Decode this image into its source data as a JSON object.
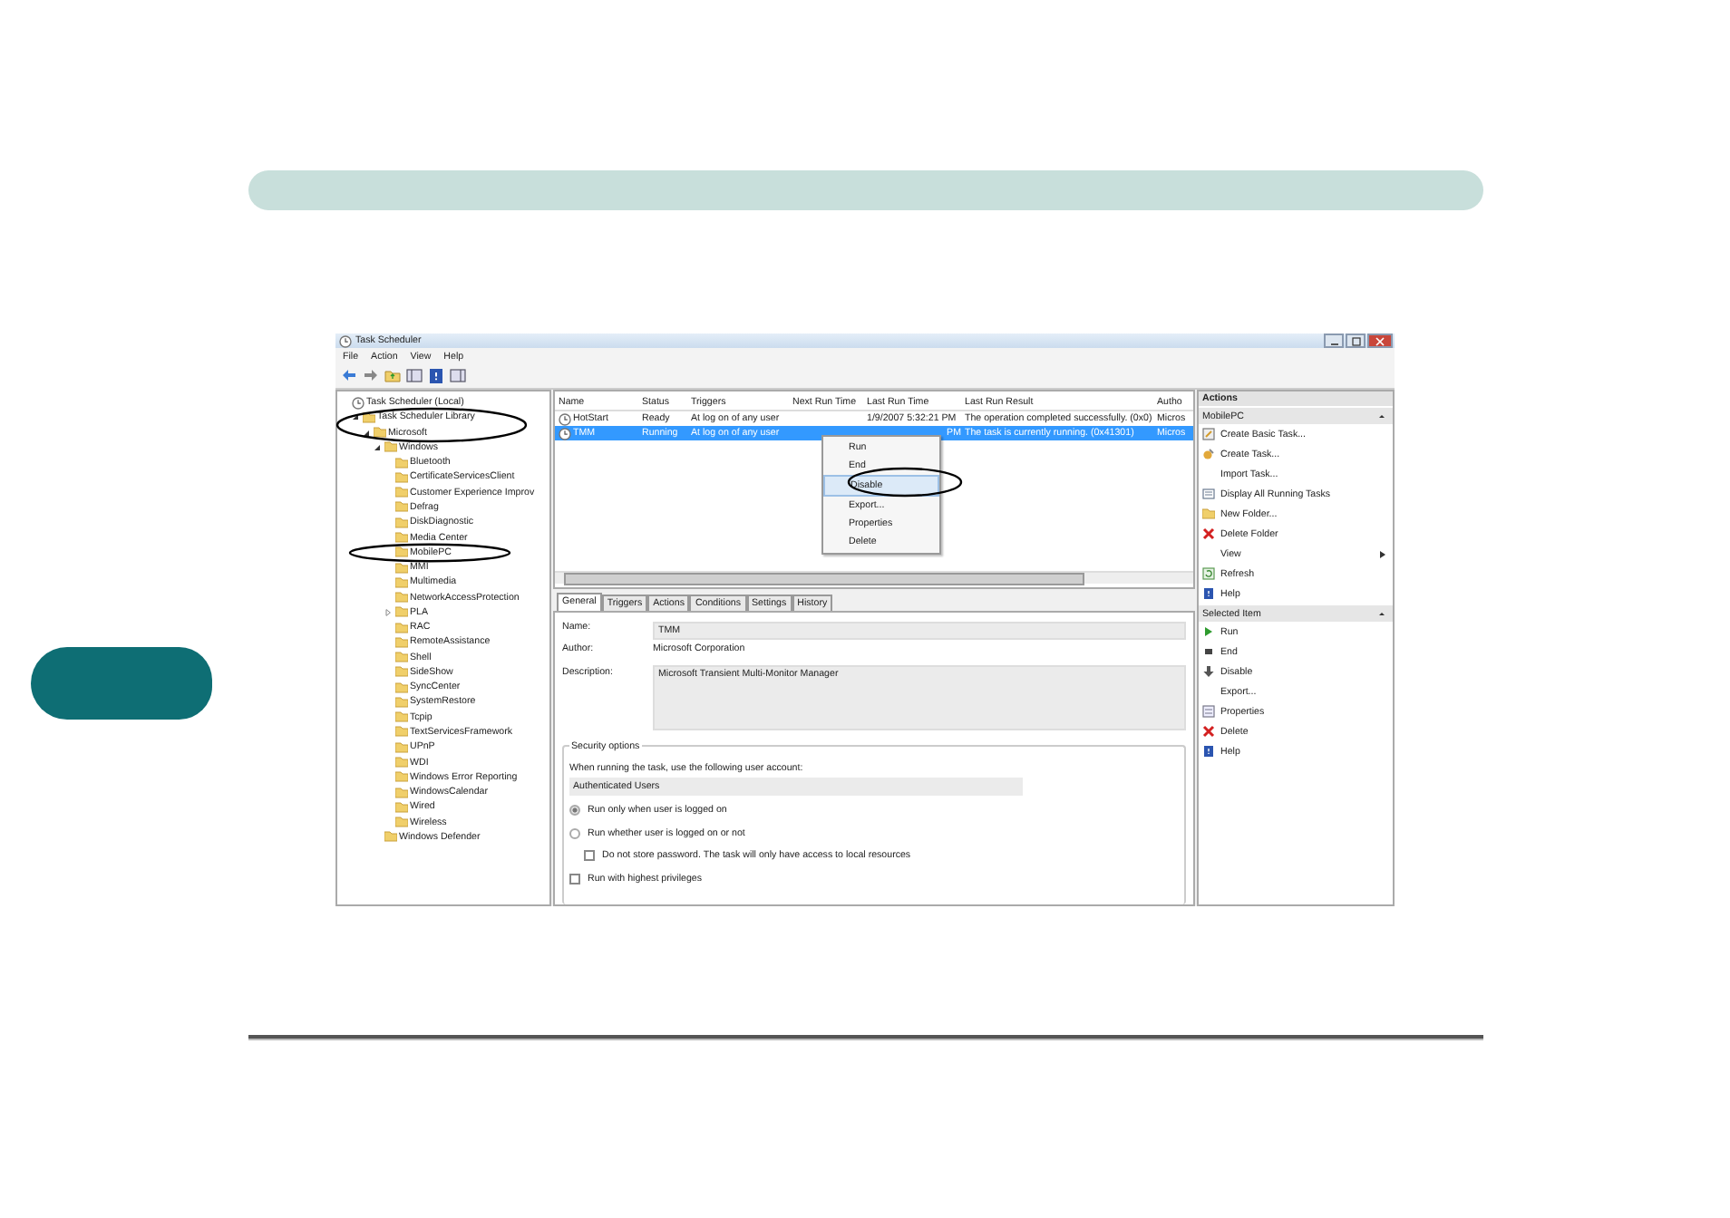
{
  "window": {
    "title": "Task Scheduler"
  },
  "menu": [
    "File",
    "Action",
    "View",
    "Help"
  ],
  "tree": [
    {
      "label": "Task Scheduler (Local)",
      "children": [
        {
          "label": "Task Scheduler Library",
          "expanded": true,
          "children": [
            {
              "label": "Microsoft",
              "expanded": true,
              "children": [
                {
                  "label": "Windows",
                  "expanded": true,
                  "children": [
                    {
                      "label": "Bluetooth"
                    },
                    {
                      "label": "CertificateServicesClient"
                    },
                    {
                      "label": "Customer Experience Improv"
                    },
                    {
                      "label": "Defrag"
                    },
                    {
                      "label": "DiskDiagnostic"
                    },
                    {
                      "label": "Media Center"
                    },
                    {
                      "label": "MobilePC"
                    },
                    {
                      "label": "MMI"
                    },
                    {
                      "label": "Multimedia"
                    },
                    {
                      "label": "NetworkAccessProtection"
                    },
                    {
                      "label": "PLA",
                      "expanded": false
                    },
                    {
                      "label": "RAC"
                    },
                    {
                      "label": "RemoteAssistance"
                    },
                    {
                      "label": "Shell"
                    },
                    {
                      "label": "SideShow"
                    },
                    {
                      "label": "SyncCenter"
                    },
                    {
                      "label": "SystemRestore"
                    },
                    {
                      "label": "Tcpip"
                    },
                    {
                      "label": "TextServicesFramework"
                    },
                    {
                      "label": "UPnP"
                    },
                    {
                      "label": "WDI"
                    },
                    {
                      "label": "Windows Error Reporting"
                    },
                    {
                      "label": "WindowsCalendar"
                    },
                    {
                      "label": "Wired"
                    },
                    {
                      "label": "Wireless"
                    }
                  ]
                },
                {
                  "label": "Windows Defender"
                }
              ]
            }
          ]
        }
      ]
    }
  ],
  "tasks": {
    "columns": [
      "Name",
      "Status",
      "Triggers",
      "Next Run Time",
      "Last Run Time",
      "Last Run Result",
      "Autho"
    ],
    "rows": [
      {
        "selected": false,
        "cells": [
          "HotStart",
          "Ready",
          "At log on of any user",
          "",
          "1/9/2007 5:32:21 PM",
          "The operation completed successfully. (0x0)",
          "Micros"
        ]
      },
      {
        "selected": true,
        "cells": [
          "TMM",
          "Running",
          "At log on of any user",
          "",
          "PM",
          "The task is currently running. (0x41301)",
          "Micros"
        ]
      }
    ]
  },
  "context_menu": [
    {
      "label": "Run",
      "selected": false
    },
    {
      "label": "End",
      "selected": false
    },
    {
      "label": "Disable",
      "selected": true
    },
    {
      "label": "Export...",
      "selected": false
    },
    {
      "label": "Properties",
      "selected": false
    },
    {
      "label": "Delete",
      "selected": false
    }
  ],
  "detail_tabs": [
    {
      "label": "General",
      "selected": true
    },
    {
      "label": "Triggers",
      "selected": false
    },
    {
      "label": "Actions",
      "selected": false
    },
    {
      "label": "Conditions",
      "selected": false
    },
    {
      "label": "Settings",
      "selected": false
    },
    {
      "label": "History",
      "selected": false
    }
  ],
  "general": {
    "name_label": "Name:",
    "name": "TMM",
    "author_label": "Author:",
    "author": "Microsoft Corporation",
    "description_label": "Description:",
    "description": "Microsoft Transient Multi-Monitor Manager",
    "security": {
      "title": "Security options",
      "account_prompt": "When running the task, use the following user account:",
      "account": "Authenticated Users",
      "options": [
        {
          "kind": "radio",
          "label": "Run only when user is logged on",
          "checked": true
        },
        {
          "kind": "radio",
          "label": "Run whether user is logged on or not",
          "checked": false,
          "children": [
            {
              "kind": "checkbox",
              "label": "Do not store password.  The task will only have access to local resources",
              "checked": false
            }
          ]
        },
        {
          "kind": "checkbox",
          "label": "Run with highest privileges",
          "checked": false
        }
      ]
    }
  },
  "actions": {
    "title": "Actions",
    "sections": [
      {
        "title": "MobilePC",
        "items": [
          {
            "label": "Create Basic Task...",
            "kind": "wizard"
          },
          {
            "label": "Create Task...",
            "kind": "task"
          },
          {
            "label": "Import Task...",
            "kind": "none"
          },
          {
            "label": "Display All Running Tasks",
            "kind": "list"
          },
          {
            "label": "New Folder...",
            "kind": "folder"
          },
          {
            "label": "Delete Folder",
            "kind": "delete"
          },
          {
            "label": "View",
            "kind": "submenu"
          },
          {
            "label": "Refresh",
            "kind": "refresh"
          },
          {
            "label": "Help",
            "kind": "help"
          }
        ]
      },
      {
        "title": "Selected Item",
        "items": [
          {
            "label": "Run",
            "kind": "run"
          },
          {
            "label": "End",
            "kind": "end"
          },
          {
            "label": "Disable",
            "kind": "disable"
          },
          {
            "label": "Export...",
            "kind": "none"
          },
          {
            "label": "Properties",
            "kind": "properties"
          },
          {
            "label": "Delete",
            "kind": "delete"
          },
          {
            "label": "Help",
            "kind": "help"
          }
        ]
      }
    ]
  }
}
